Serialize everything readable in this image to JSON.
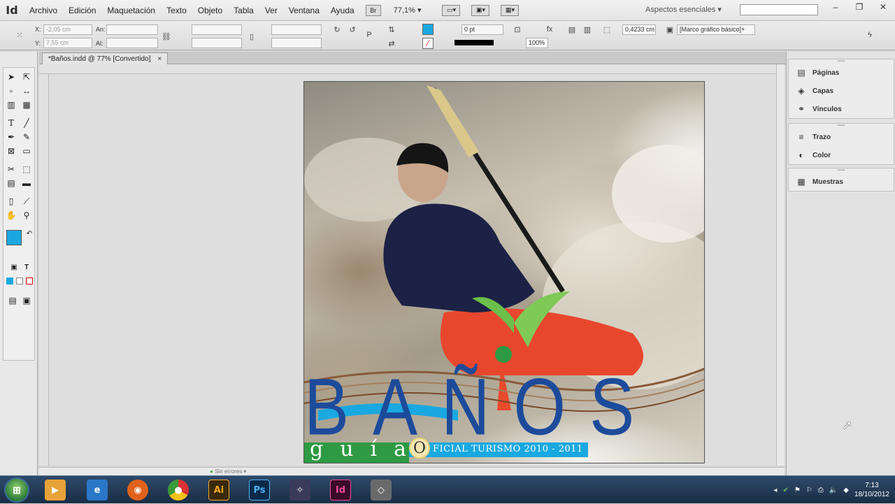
{
  "app": {
    "logo": "Id"
  },
  "menu": [
    "Archivo",
    "Edición",
    "Maquetación",
    "Texto",
    "Objeto",
    "Tabla",
    "Ver",
    "Ventana",
    "Ayuda"
  ],
  "menubar": {
    "br_label": "Br",
    "zoom": "77,1%",
    "workspace": "Aspectos esenciales"
  },
  "control": {
    "x_label": "X:",
    "x_value": "-2,05 cm",
    "y_label": "Y:",
    "y_value": "7,55 cm",
    "w_label": "An:",
    "h_label": "Al:",
    "stroke_weight": "0 pt",
    "fitting_value": "0,4233 cm",
    "opacity": "100%",
    "object_style": "[Marco gráfico básico]+"
  },
  "document": {
    "tab_title": "*Baños.indd @ 77% [Convertido]",
    "close": "×"
  },
  "status": {
    "errors": "Sin errores"
  },
  "artwork": {
    "title": "BAÑOS",
    "guia": "guía",
    "oficial": "FICIAL TURISMO 2010 - 2011",
    "o_letter": "O"
  },
  "panels": {
    "group1": [
      {
        "label": "Páginas",
        "icon": "pages-icon"
      },
      {
        "label": "Capas",
        "icon": "layers-icon"
      },
      {
        "label": "Vínculos",
        "icon": "links-icon"
      }
    ],
    "group2": [
      {
        "label": "Trazo",
        "icon": "stroke-icon"
      },
      {
        "label": "Color",
        "icon": "color-icon"
      }
    ],
    "group3": [
      {
        "label": "Muestras",
        "icon": "swatches-icon"
      }
    ]
  },
  "taskbar": {
    "apps": [
      "media-player-icon",
      "internet-explorer-icon",
      "firefox-icon",
      "chrome-icon",
      "illustrator-icon",
      "photoshop-icon",
      "app-icon",
      "indesign-icon",
      "tool-icon"
    ],
    "ai_label": "Ai",
    "ps_label": "Ps",
    "id_label": "Id",
    "time": "7:13",
    "date": "18/10/2012"
  },
  "colors": {
    "fill_swatch": "#1aa8e0",
    "accent_blue": "#1d4b9b",
    "guia_green": "#2e9a43"
  }
}
